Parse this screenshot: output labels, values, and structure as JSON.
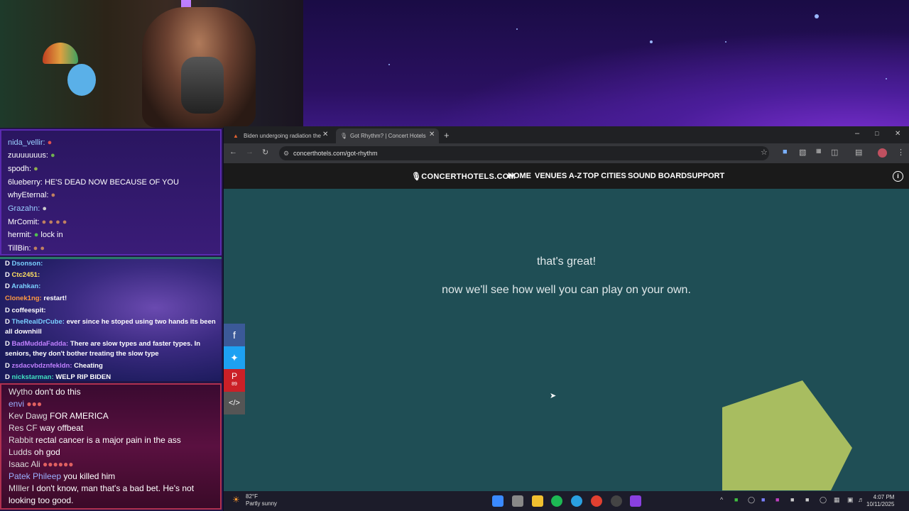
{
  "chat_top": [
    {
      "user": "nida_vellir:",
      "text": ""
    },
    {
      "user": "zuuuuuuus:",
      "text": ""
    },
    {
      "user": "spodh:",
      "text": ""
    },
    {
      "user": "6lueberry:",
      "text": "HE'S DEAD NOW BECAUSE OF YOU"
    },
    {
      "user": "whyEternal:",
      "text": ""
    },
    {
      "user": "Grazahn:",
      "text": ""
    },
    {
      "user": "MrComit:",
      "text": ""
    },
    {
      "user": "hermit:",
      "text": "lock in"
    },
    {
      "user": "TillBin:",
      "text": ""
    }
  ],
  "chat_mid": [
    {
      "user": "Dsonson:",
      "text": ""
    },
    {
      "user": "Ctc2451:",
      "text": ""
    },
    {
      "user": "Arahkan:",
      "text": ""
    },
    {
      "user": "Clonek1ng:",
      "text": "restart!"
    },
    {
      "user": "coffeespit:",
      "text": ""
    },
    {
      "user": "TheRealDrCube:",
      "text": "ever since he stoped using two hands its been"
    },
    {
      "user": "",
      "text": "all downhill"
    },
    {
      "user": "BadMuddaFadda:",
      "text": "There are slow types and faster types. In"
    },
    {
      "user": "",
      "text": "seniors, they don't bother treating the slow type"
    },
    {
      "user": "zsdacvbdznfekldn:",
      "text": "Cheating"
    },
    {
      "user": "nickstarman:",
      "text": "WELP RIP BIDEN"
    }
  ],
  "chat_bottom": [
    {
      "user": "Wytho",
      "text": "don't do this"
    },
    {
      "user": "envi",
      "text": ""
    },
    {
      "user": "Kev Dawg",
      "text": "FOR AMERICA"
    },
    {
      "user": "Res CF",
      "text": "way offbeat"
    },
    {
      "user": "Rabbit",
      "text": "rectal cancer is a major pain in the ass"
    },
    {
      "user": "Ludds",
      "text": "oh god"
    },
    {
      "user": "Isaac Ali",
      "text": ""
    },
    {
      "user": "Patek Phileep",
      "text": "you killed him"
    },
    {
      "user": "MIller",
      "text": "I don't know, man that's a bad bet. He's not"
    },
    {
      "user": "",
      "text": "looking too good."
    }
  ],
  "browser": {
    "tabs": [
      {
        "label": "Biden undergoing radiation the"
      },
      {
        "label": "Got Rhythm? | Concert Hotels"
      }
    ],
    "url": "concerthotels.com/got-rhythm"
  },
  "site": {
    "logo": "CONCERTHOTELS.COM",
    "nav": [
      "HOME",
      "VENUES A-Z",
      "TOP CITIES",
      "SOUND BOARD",
      "SUPPORT"
    ],
    "message1": "that's great!",
    "message2": "now we'll see how well you can play on your own.",
    "pinterest_count": "89",
    "shape_color": "#a8bd60"
  },
  "taskbar": {
    "temp": "82°F",
    "weather": "Partly sunny",
    "time": "4:07 PM",
    "date": "10/11/2025"
  }
}
